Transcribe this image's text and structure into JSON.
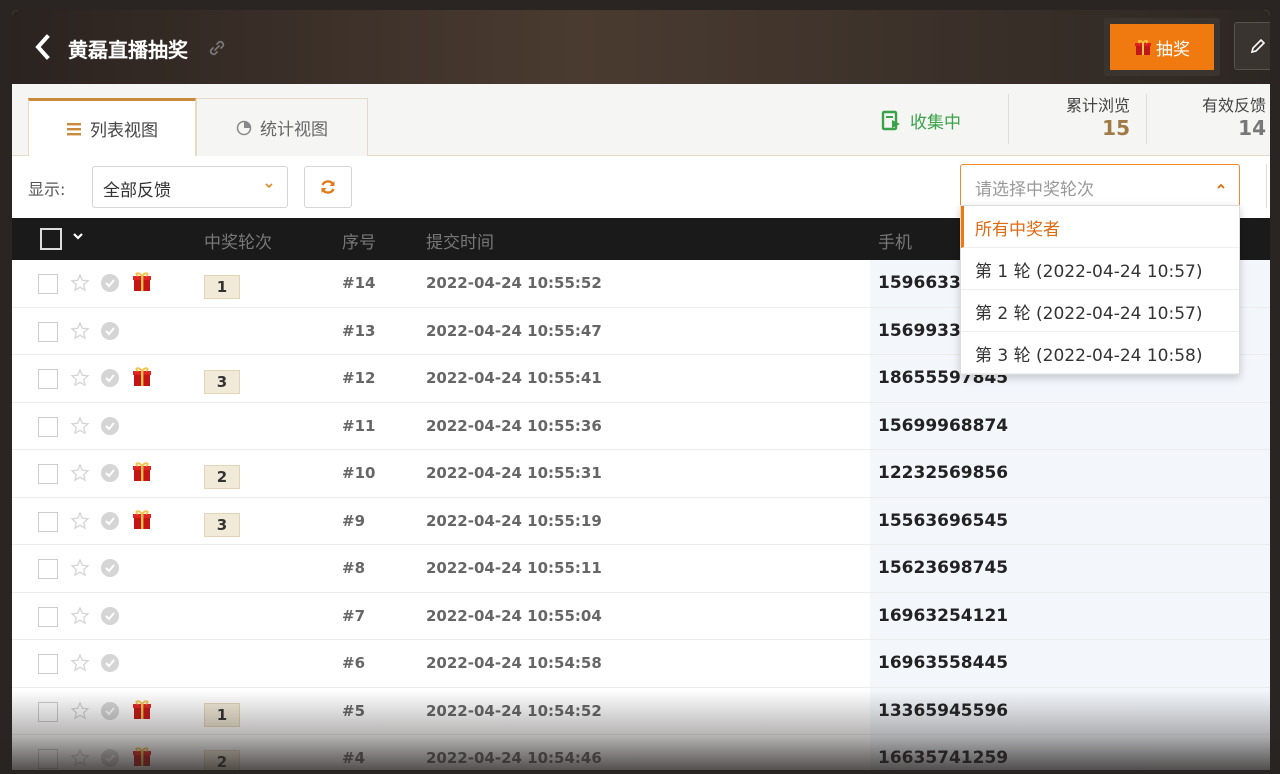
{
  "header": {
    "title": "黄磊直播抽奖",
    "draw_button": "抽奖"
  },
  "tabs": {
    "list": "列表视图",
    "stats": "统计视图"
  },
  "status": {
    "collecting": "收集中",
    "views_label": "累计浏览",
    "views_value": "15",
    "feedback_label": "有效反馈",
    "feedback_value": "14"
  },
  "filter": {
    "show_label": "显示:",
    "show_value": "全部反馈",
    "round_placeholder": "请选择中奖轮次"
  },
  "columns": {
    "round": "中奖轮次",
    "seq": "序号",
    "time": "提交时间",
    "phone": "手机"
  },
  "dropdown": {
    "options": [
      "所有中奖者",
      "第 1 轮 (2022-04-24 10:57)",
      "第 2 轮 (2022-04-24 10:57)",
      "第 3 轮 (2022-04-24 10:58)"
    ]
  },
  "rows": [
    {
      "gift": true,
      "round": "1",
      "seq": "#14",
      "time": "2022-04-24 10:55:52",
      "phone": "15966332"
    },
    {
      "gift": false,
      "round": "",
      "seq": "#13",
      "time": "2022-04-24 10:55:47",
      "phone": "1569933"
    },
    {
      "gift": true,
      "round": "3",
      "seq": "#12",
      "time": "2022-04-24 10:55:41",
      "phone": "18655597845"
    },
    {
      "gift": false,
      "round": "",
      "seq": "#11",
      "time": "2022-04-24 10:55:36",
      "phone": "15699968874"
    },
    {
      "gift": true,
      "round": "2",
      "seq": "#10",
      "time": "2022-04-24 10:55:31",
      "phone": "12232569856"
    },
    {
      "gift": true,
      "round": "3",
      "seq": "#9",
      "time": "2022-04-24 10:55:19",
      "phone": "15563696545"
    },
    {
      "gift": false,
      "round": "",
      "seq": "#8",
      "time": "2022-04-24 10:55:11",
      "phone": "15623698745"
    },
    {
      "gift": false,
      "round": "",
      "seq": "#7",
      "time": "2022-04-24 10:55:04",
      "phone": "16963254121"
    },
    {
      "gift": false,
      "round": "",
      "seq": "#6",
      "time": "2022-04-24 10:54:58",
      "phone": "16963558445"
    },
    {
      "gift": true,
      "round": "1",
      "seq": "#5",
      "time": "2022-04-24 10:54:52",
      "phone": "13365945596"
    },
    {
      "gift": true,
      "round": "2",
      "seq": "#4",
      "time": "2022-04-24 10:54:46",
      "phone": "16635741259"
    }
  ],
  "colors": {
    "accent": "#f07a10",
    "header_bg": "#2b2320",
    "collect_green": "#3aa34a",
    "stat_gold": "#a07a45"
  }
}
